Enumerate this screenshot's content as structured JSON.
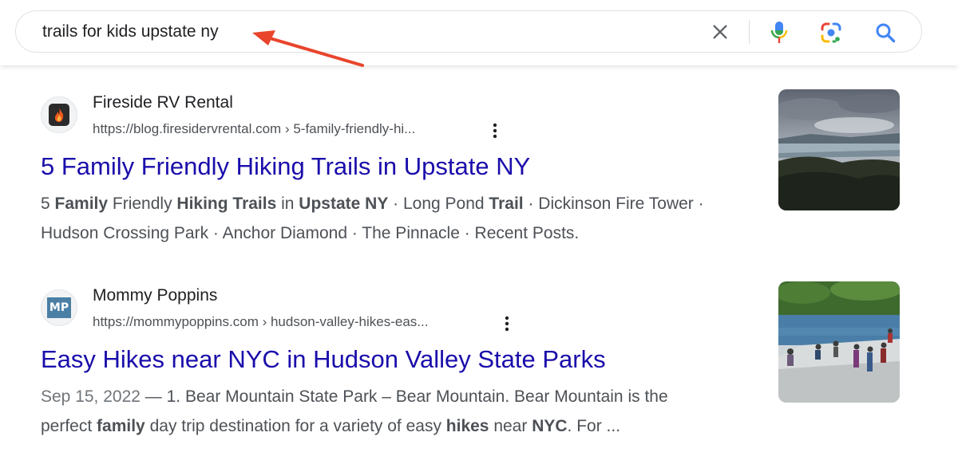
{
  "search": {
    "query": "trails for kids upstate ny"
  },
  "icons": {
    "clear": "close-icon",
    "voice": "microphone-icon",
    "lens": "google-lens-icon",
    "search": "magnifier-icon",
    "more": "three-dot-vertical-icon",
    "annotation": "red-arrow"
  },
  "colors": {
    "link": "#1a0dab",
    "snippet": "#4d5156",
    "annotation_arrow": "#e8452c"
  },
  "results": [
    {
      "site_name": "Fireside RV Rental",
      "url": "https://blog.firesidervrental.com › 5-family-friendly-hi...",
      "title": "5 Family Friendly Hiking Trails in Upstate NY",
      "favicon": "fire-logo",
      "snippet_lines": [
        [
          "5 ",
          "Family",
          " Friendly ",
          "Hiking Trails",
          " in ",
          "Upstate NY",
          " · Long Pond ",
          "Trail",
          " · Dickinson Fire Tower ·"
        ],
        [
          "Hudson Crossing Park · Anchor Diamond · The Pinnacle · Recent Posts."
        ]
      ]
    },
    {
      "site_name": "Mommy Poppins",
      "url": "https://mommypoppins.com › hudson-valley-hikes-eas...",
      "title": "Easy Hikes near NYC in Hudson Valley State Parks",
      "favicon": "MP",
      "date": "Sep 15, 2022",
      "snippet_lines": [
        [
          " — 1. Bear Mountain State Park – Bear Mountain. Bear Mountain is the"
        ],
        [
          "perfect ",
          "family",
          " day trip destination for a variety of easy ",
          "hikes",
          " near ",
          "NYC",
          ". For ..."
        ]
      ]
    }
  ]
}
